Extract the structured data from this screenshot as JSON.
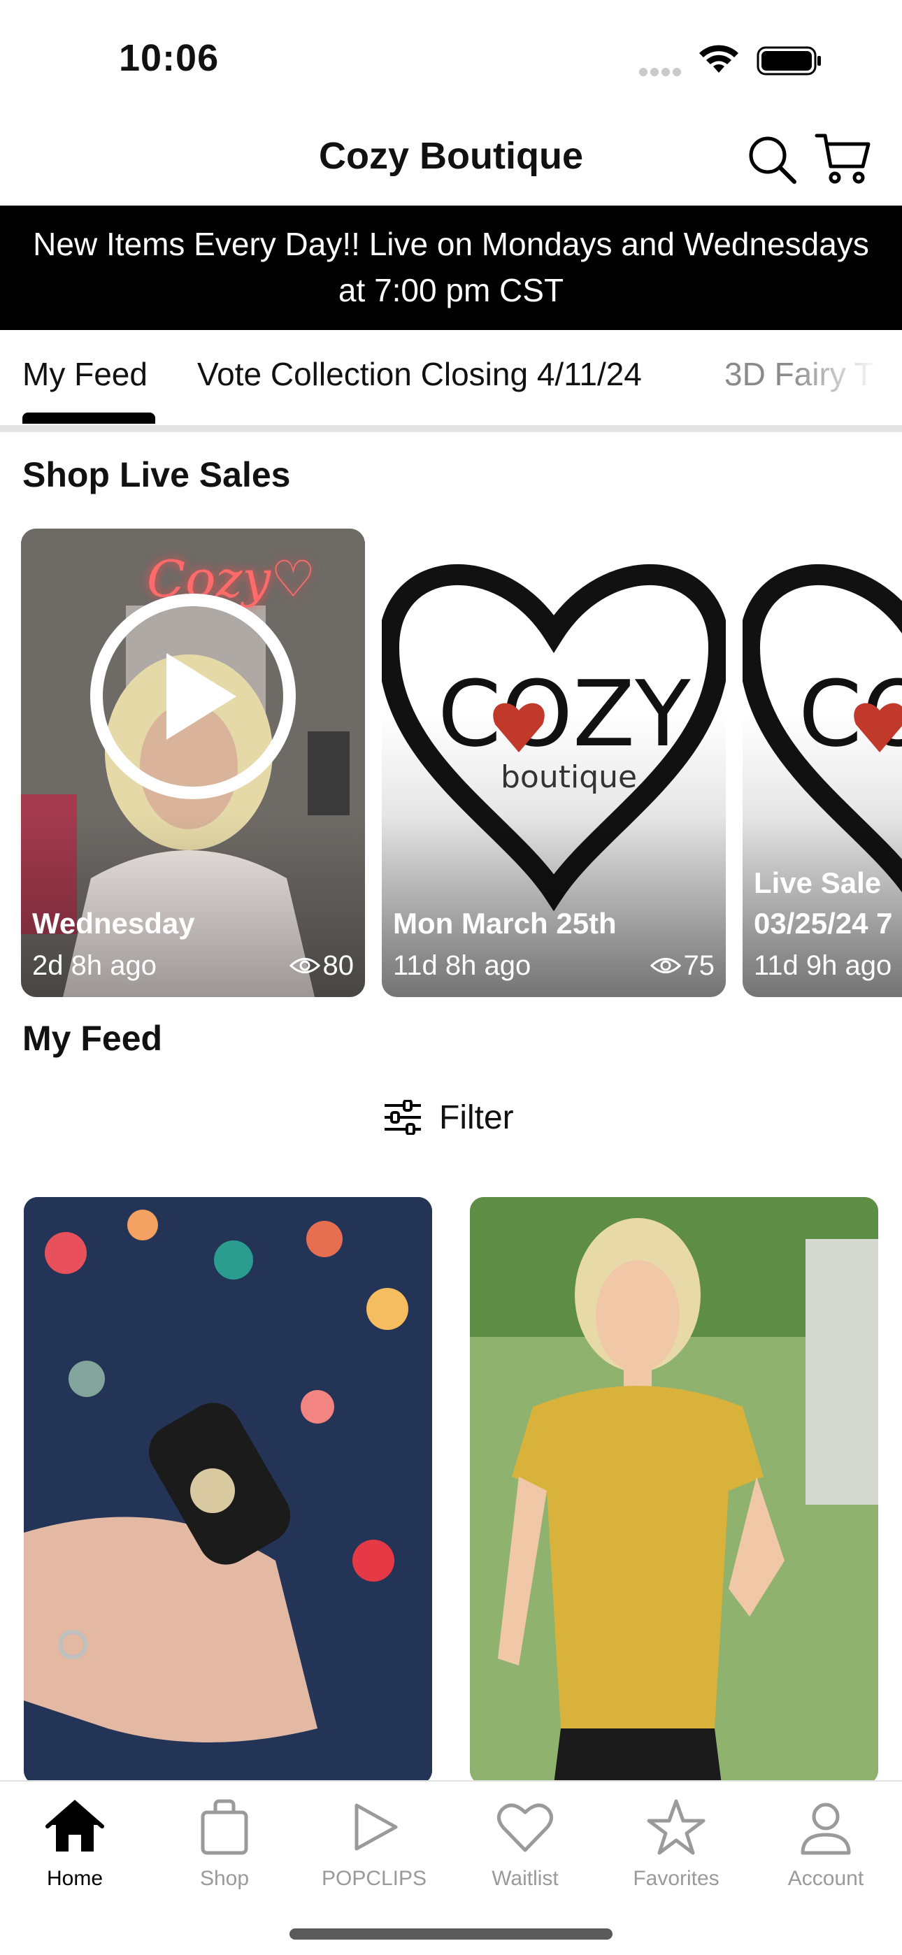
{
  "status_bar": {
    "time": "10:06"
  },
  "header": {
    "title": "Cozy Boutique"
  },
  "banner": {
    "line1": "New Items Every Day!! Live on Mondays and Wednesdays",
    "line2": "at 7:00 pm CST"
  },
  "tabs": [
    {
      "label": "My Feed",
      "active": true
    },
    {
      "label": "Vote Collection Closing 4/11/24",
      "active": false
    },
    {
      "label": "3D Fairy T",
      "active": false
    }
  ],
  "live_section": {
    "title": "Shop Live Sales",
    "cards": [
      {
        "title": "Wednesday",
        "ago": "2d 8h ago",
        "views": "80",
        "sign": "Cozy♡"
      },
      {
        "title": "Mon March 25th",
        "ago": "11d 8h ago",
        "views": "75",
        "logo": "COZY",
        "logo_sub": "boutique"
      },
      {
        "title_line1": "Live Sale",
        "title_line2": "03/25/24 7",
        "ago": "11d 9h ago",
        "logo": "CO"
      }
    ]
  },
  "feed_section": {
    "title": "My Feed",
    "filter_label": "Filter"
  },
  "bottom_nav": [
    {
      "label": "Home",
      "icon": "home-icon",
      "active": true
    },
    {
      "label": "Shop",
      "icon": "shopping-bag-icon",
      "active": false
    },
    {
      "label": "POPCLIPS",
      "icon": "play-icon",
      "active": false
    },
    {
      "label": "Waitlist",
      "icon": "heart-icon",
      "active": false
    },
    {
      "label": "Favorites",
      "icon": "star-icon",
      "active": false
    },
    {
      "label": "Account",
      "icon": "person-icon",
      "active": false
    }
  ],
  "colors": {
    "accent": "#000000",
    "banner_bg": "#000000",
    "inactive": "#9a9a9a",
    "logo_heart": "#c0392b"
  }
}
